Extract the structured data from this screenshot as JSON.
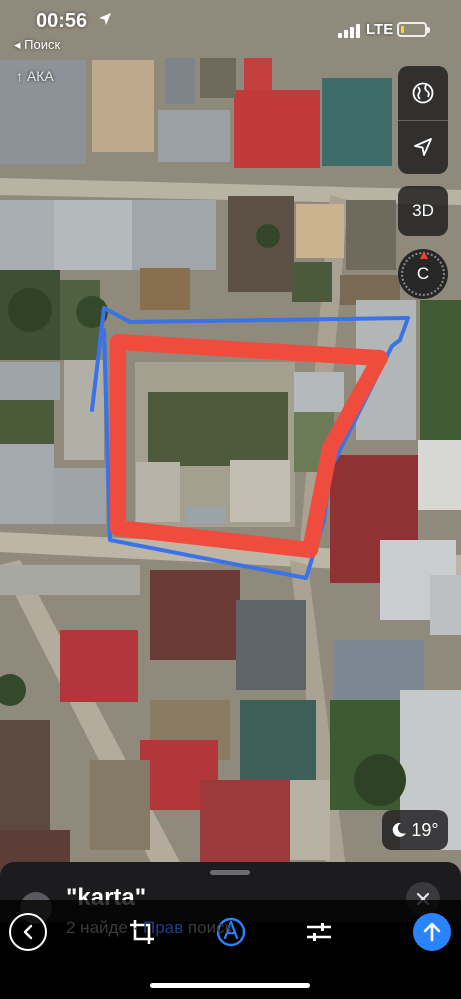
{
  "status_bar": {
    "time": "00:56",
    "back_label": "Поиск",
    "network": "LTE",
    "battery_level": 0.12,
    "battery_color": "#ffd60a"
  },
  "map": {
    "partial_label": "АКА",
    "annotation_colors": {
      "outer_outline": "#3a72e8",
      "inner_outline": "#f04c3e"
    }
  },
  "controls": {
    "globe_icon": "globe-icon",
    "location_icon": "location-arrow-icon",
    "view_3d_label": "3D",
    "compass_letter": "C",
    "weather": {
      "icon": "moon-icon",
      "temperature": "19°"
    }
  },
  "result_card": {
    "title": "\"karta\"",
    "subtitle_count": "2 найде",
    "subtitle_link": "Прав",
    "subtitle_tail": "поиск",
    "close_icon": "close-icon"
  },
  "toolbar": {
    "items": [
      "back-icon",
      "crop-icon",
      "markup-pen-icon",
      "adjust-icon",
      "send-icon"
    ],
    "accent": "#2a84ff"
  }
}
